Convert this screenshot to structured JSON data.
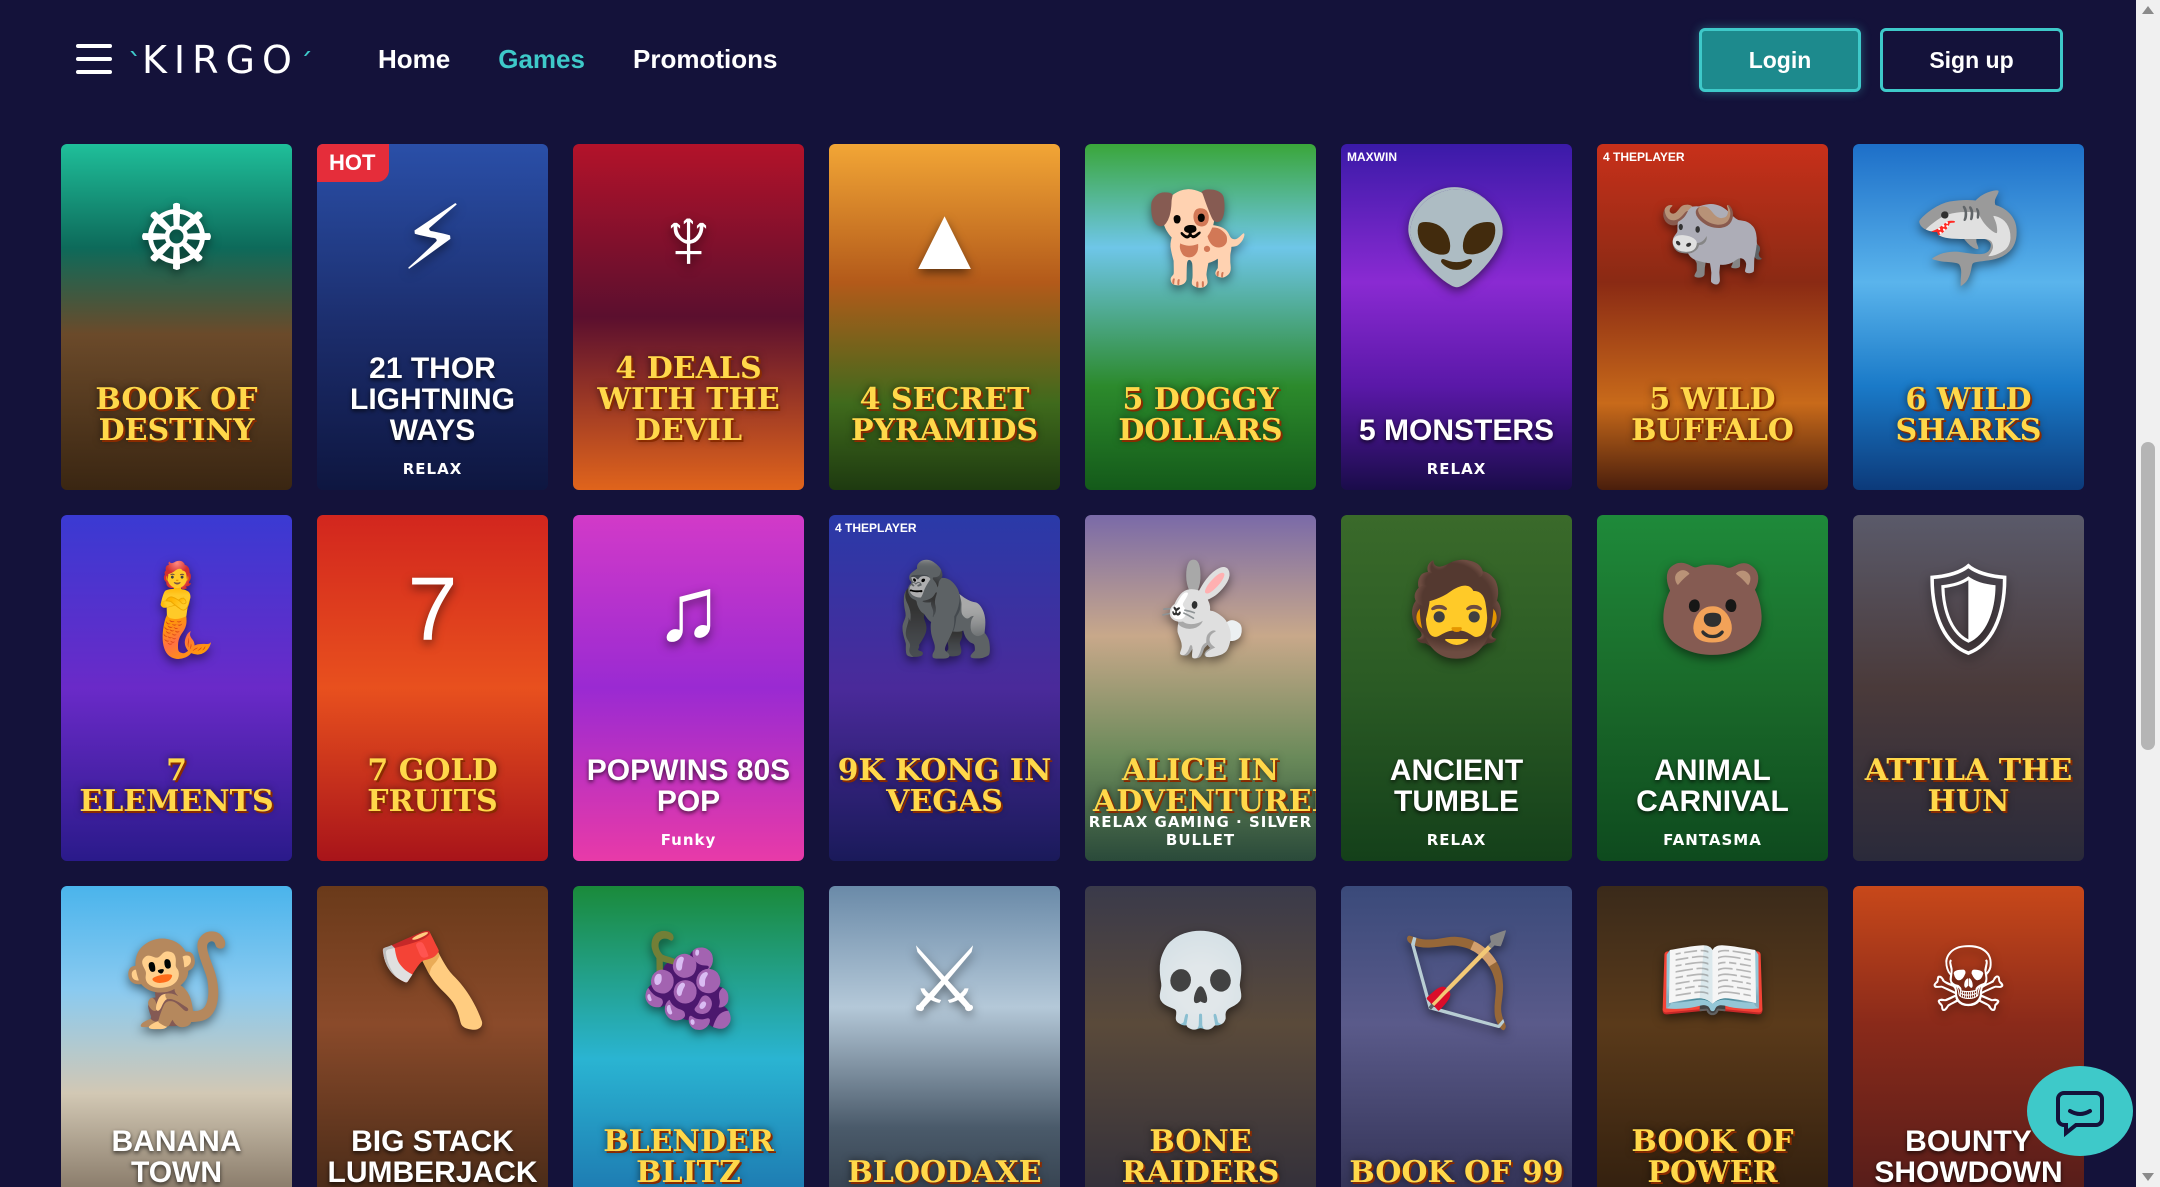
{
  "header": {
    "logo": "KIRGO",
    "nav": [
      {
        "label": "Home",
        "active": false
      },
      {
        "label": "Games",
        "active": true
      },
      {
        "label": "Promotions",
        "active": false
      }
    ],
    "login_label": "Login",
    "signup_label": "Sign up"
  },
  "colors": {
    "background": "#14123a",
    "accent": "#3ec9c9",
    "hot_badge": "#e52d3a"
  },
  "games": [
    {
      "title": "BOOK of DESTINY",
      "provider": "",
      "badge": "",
      "top_logo": "",
      "icon": "wheel-icon"
    },
    {
      "title": "21 THOR LIGHTNING WAYS",
      "provider": "RELAX",
      "badge": "HOT",
      "top_logo": "",
      "icon": "thor-icon"
    },
    {
      "title": "4 DEALS WITH THE DEVIL",
      "provider": "",
      "badge": "",
      "top_logo": "",
      "icon": "devil-icon"
    },
    {
      "title": "4 SECRET PYRAMIDS",
      "provider": "",
      "badge": "",
      "top_logo": "",
      "icon": "pyramid-icon"
    },
    {
      "title": "5 DOGGY DOLLARS",
      "provider": "",
      "badge": "",
      "top_logo": "",
      "icon": "dog-icon"
    },
    {
      "title": "5 Monsters",
      "provider": "RELAX",
      "badge": "",
      "top_logo": "MAXWIN",
      "icon": "alien-icon"
    },
    {
      "title": "5 WILD BUFFALO",
      "provider": "",
      "badge": "",
      "top_logo": "4 THEPLAYER",
      "icon": "buffalo-icon"
    },
    {
      "title": "6 WILD SHARKS",
      "provider": "",
      "badge": "",
      "top_logo": "",
      "icon": "shark-icon"
    },
    {
      "title": "7 ELEMENTS",
      "provider": "",
      "badge": "",
      "top_logo": "",
      "icon": "goddess-icon"
    },
    {
      "title": "7 GOLD FRUITS",
      "provider": "",
      "badge": "",
      "top_logo": "",
      "icon": "seven-icon"
    },
    {
      "title": "POPWINS 80s POP",
      "provider": "Funky",
      "badge": "",
      "top_logo": "",
      "icon": "music-icon"
    },
    {
      "title": "9K KONG IN VEGAS",
      "provider": "",
      "badge": "",
      "top_logo": "4 THEPLAYER",
      "icon": "gorilla-icon"
    },
    {
      "title": "ALICE IN ADVENTURELAND",
      "provider": "RELAX GAMING · SILVER BULLET",
      "badge": "",
      "top_logo": "",
      "icon": "rabbit-icon"
    },
    {
      "title": "ANCIENT TUMBLE",
      "provider": "RELAX",
      "badge": "",
      "top_logo": "",
      "icon": "man-icon"
    },
    {
      "title": "ANIMAL CARNIVAL",
      "provider": "FANTASMA",
      "badge": "",
      "top_logo": "",
      "icon": "bear-icon"
    },
    {
      "title": "ATTILA THE HUN",
      "provider": "",
      "badge": "",
      "top_logo": "",
      "icon": "shield-icon"
    },
    {
      "title": "BANANA TOWN",
      "provider": "",
      "badge": "",
      "top_logo": "",
      "icon": "monkey-icon"
    },
    {
      "title": "BIG STACK LUMBERJACK",
      "provider": "",
      "badge": "",
      "top_logo": "",
      "icon": "axe-icon"
    },
    {
      "title": "BLENDER BLITZ",
      "provider": "",
      "badge": "",
      "top_logo": "",
      "icon": "fruit-icon"
    },
    {
      "title": "BLOODAXE",
      "provider": "",
      "badge": "",
      "top_logo": "",
      "icon": "viking-icon"
    },
    {
      "title": "BONE RAIDERS",
      "provider": "",
      "badge": "",
      "top_logo": "",
      "icon": "skull-icon"
    },
    {
      "title": "BOOK OF 99",
      "provider": "",
      "badge": "",
      "top_logo": "",
      "icon": "archer-icon"
    },
    {
      "title": "BOOK OF POWER",
      "provider": "",
      "badge": "",
      "top_logo": "",
      "icon": "book-icon"
    },
    {
      "title": "BOUNTY SHOWDOWN",
      "provider": "",
      "badge": "",
      "top_logo": "",
      "icon": "cowboy-skull-icon"
    }
  ]
}
